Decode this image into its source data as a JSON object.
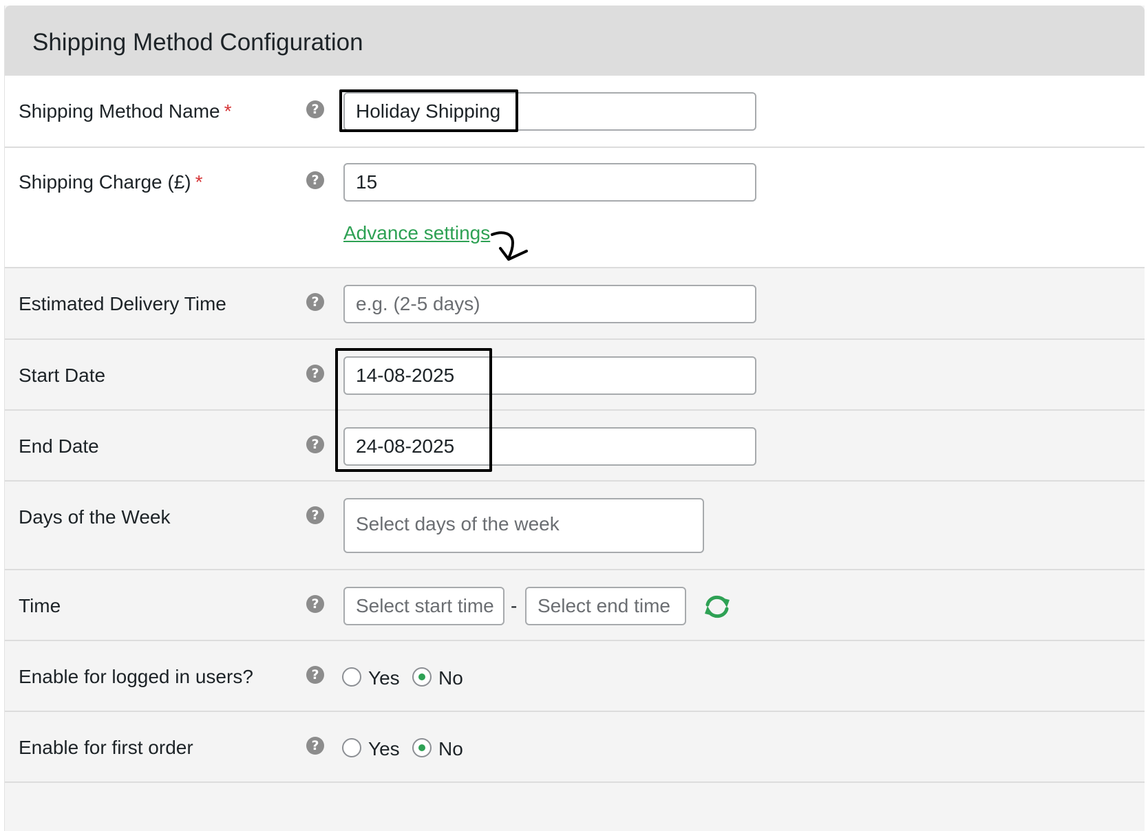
{
  "panel": {
    "title": "Shipping Method Configuration"
  },
  "fields": {
    "method_name": {
      "label": "Shipping Method Name",
      "required_mark": "*",
      "value": "Holiday Shipping"
    },
    "charge": {
      "label": "Shipping Charge (£)",
      "required_mark": "*",
      "value": "15",
      "advance_link": "Advance settings"
    },
    "delivery_time": {
      "label": "Estimated Delivery Time",
      "value": "",
      "placeholder": "e.g. (2-5 days)"
    },
    "start_date": {
      "label": "Start Date",
      "value": "14-08-2025"
    },
    "end_date": {
      "label": "End Date",
      "value": "24-08-2025"
    },
    "days_of_week": {
      "label": "Days of the Week",
      "placeholder": "Select days of the week"
    },
    "time": {
      "label": "Time",
      "start_placeholder": "Select start time",
      "separator": "-",
      "end_placeholder": "Select end time"
    },
    "logged_in": {
      "label": "Enable for logged in users?",
      "options": [
        "Yes",
        "No"
      ],
      "selected": "No"
    },
    "first_order": {
      "label": "Enable for first order",
      "options": [
        "Yes",
        "No"
      ],
      "selected": "No"
    }
  },
  "help_glyph": "?",
  "colors": {
    "accent_green": "#2ea154",
    "required_red": "#d63638",
    "header_bg": "#dddddd"
  },
  "icons": {
    "help": "question-circle-icon",
    "reset_time": "refresh-icon",
    "annotation_arrow": "curved-arrow-down-icon"
  }
}
